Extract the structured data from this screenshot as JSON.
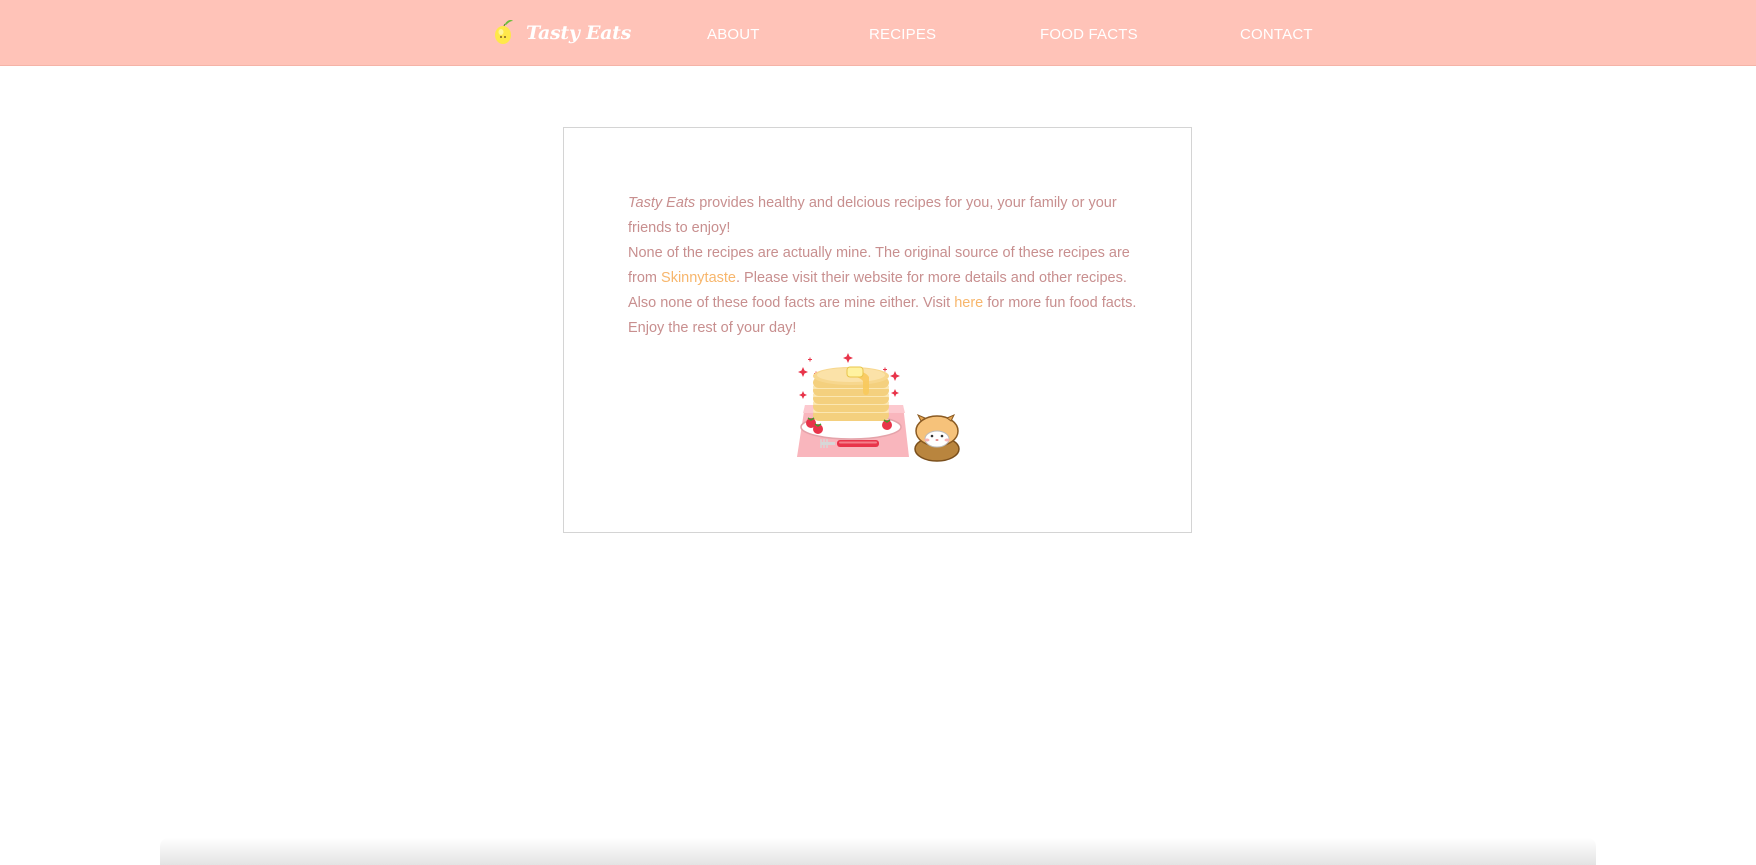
{
  "header": {
    "brand": {
      "icon": "lemon-icon",
      "name": "Tasty Eats"
    },
    "nav": [
      {
        "label": "ABOUT"
      },
      {
        "label": "RECIPES"
      },
      {
        "label": "FOOD FACTS"
      },
      {
        "label": "CONTACT"
      }
    ]
  },
  "about": {
    "brand_inline": "Tasty Eats",
    "line1_rest": " provides healthy and delcious recipes for you, your family or your friends to enjoy!",
    "line2_start": "None of the recipes are actually mine. The original source of these recipes are from ",
    "source_link": "Skinnytaste",
    "line2_mid": ". Please visit their website for more details and other recipes. Also none of these food facts are mine either. Visit ",
    "facts_link": "here",
    "line2_end": " for more fun food facts. Enjoy the rest of your day!",
    "illustration": "pancake-stack-with-hamster-illustration"
  },
  "colors": {
    "header_bg": "#ffc3b8",
    "text": "#c88f8f",
    "link": "#f7b66c",
    "nav_text": "#ffffff"
  }
}
